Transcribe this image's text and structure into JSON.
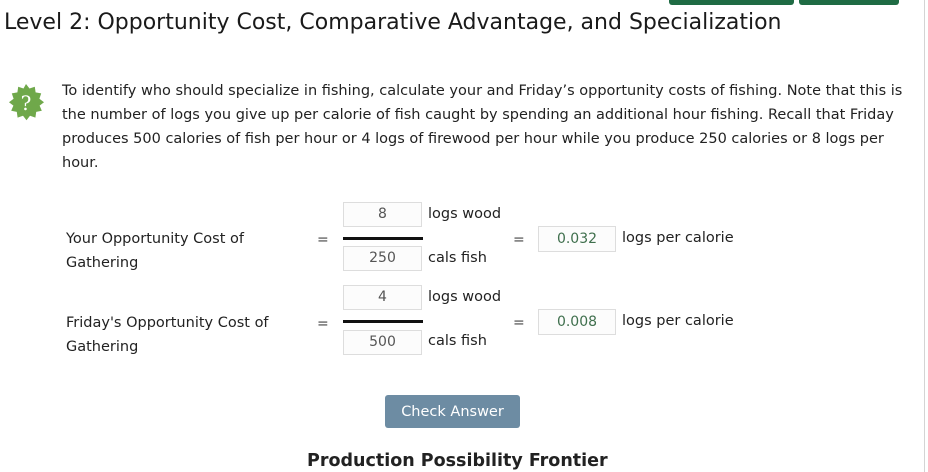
{
  "page": {
    "title": "Level 2: Opportunity Cost, Comparative Advantage, and Specialization",
    "help_icon": "question-mark-seal-icon",
    "accent_color": "#6fa84a",
    "button_color": "#6d8ca3",
    "instructions": "To identify who should specialize in fishing, calculate your and Friday’s opportunity costs of fishing. Note that this is the number of logs you give up per calorie of fish caught by spending an additional hour fishing. Recall that Friday produces 500 calories of fish per hour or 4 logs of firewood per hour while you produce 250 calories or 8 logs per hour."
  },
  "rows": [
    {
      "label": "Your Opportunity Cost of Gathering",
      "numerator": "8",
      "numerator_unit": "logs wood",
      "denominator": "250",
      "denominator_unit": "cals fish",
      "result": "0.032",
      "result_unit": "logs per calorie"
    },
    {
      "label": "Friday's Opportunity Cost of Gathering",
      "numerator": "4",
      "numerator_unit": "logs wood",
      "denominator": "500",
      "denominator_unit": "cals fish",
      "result": "0.008",
      "result_unit": "logs per calorie"
    }
  ],
  "equals_sign": "=",
  "check_button_label": "Check Answer",
  "next_section_title": "Production Possibility Frontier"
}
